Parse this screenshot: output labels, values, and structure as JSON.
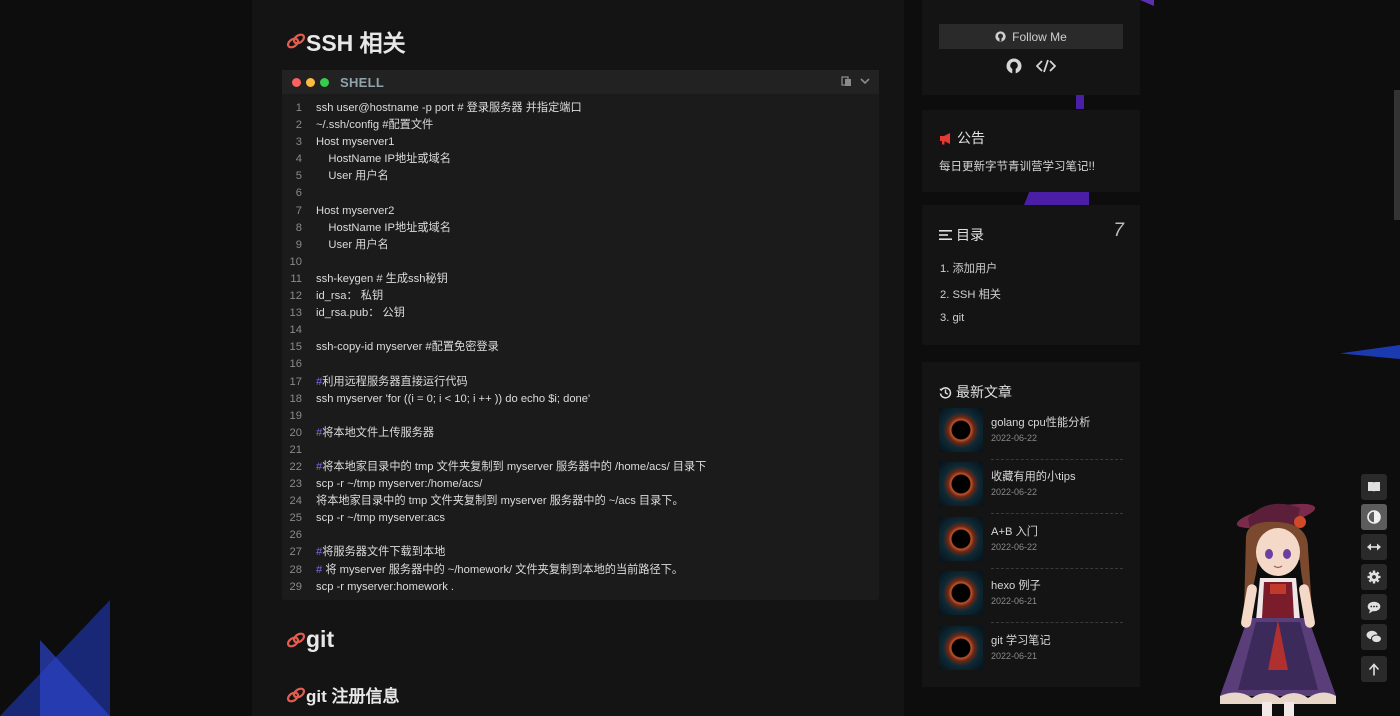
{
  "article": {
    "ssh_heading": "SSH 相关",
    "code_lang": "SHELL",
    "code_lines": [
      {
        "n": "1",
        "text": "ssh user@hostname -p port # 登录服务器 并指定端口"
      },
      {
        "n": "2",
        "text": "~/.ssh/config #配置文件"
      },
      {
        "n": "3",
        "text": "Host myserver1"
      },
      {
        "n": "4",
        "text": "    HostName IP地址或域名"
      },
      {
        "n": "5",
        "text": "    User 用户名"
      },
      {
        "n": "6",
        "text": ""
      },
      {
        "n": "7",
        "text": "Host myserver2"
      },
      {
        "n": "8",
        "text": "    HostName IP地址或域名"
      },
      {
        "n": "9",
        "text": "    User 用户名"
      },
      {
        "n": "10",
        "text": ""
      },
      {
        "n": "11",
        "text": "ssh-keygen # 生成ssh秘钥"
      },
      {
        "n": "12",
        "text": "id_rsa： 私钥"
      },
      {
        "n": "13",
        "text": "id_rsa.pub： 公钥"
      },
      {
        "n": "14",
        "text": ""
      },
      {
        "n": "15",
        "text": "ssh-copy-id myserver #配置免密登录"
      },
      {
        "n": "16",
        "text": ""
      },
      {
        "n": "17",
        "hash": "#",
        "text": "利用远程服务器直接运行代码"
      },
      {
        "n": "18",
        "text": "ssh myserver 'for ((i = 0; i < 10; i ++ )) do echo $i; done'"
      },
      {
        "n": "19",
        "text": ""
      },
      {
        "n": "20",
        "hash": "#",
        "text": "将本地文件上传服务器"
      },
      {
        "n": "21",
        "text": ""
      },
      {
        "n": "22",
        "hash": "#",
        "text": "将本地家目录中的 tmp 文件夹复制到 myserver 服务器中的 /home/acs/ 目录下"
      },
      {
        "n": "23",
        "text": "scp -r ~/tmp myserver:/home/acs/"
      },
      {
        "n": "24",
        "text": "将本地家目录中的 tmp 文件夹复制到 myserver 服务器中的 ~/acs 目录下。"
      },
      {
        "n": "25",
        "text": "scp -r ~/tmp myserver:acs"
      },
      {
        "n": "26",
        "text": ""
      },
      {
        "n": "27",
        "hash": "#",
        "text": "将服务器文件下载到本地"
      },
      {
        "n": "28",
        "hash": "#",
        "text": " 将 myserver 服务器中的 ~/homework/ 文件夹复制到本地的当前路径下。"
      },
      {
        "n": "29",
        "text": "scp -r myserver:homework ."
      }
    ],
    "git_heading": "git",
    "git_sub_heading": "git 注册信息"
  },
  "sidebar": {
    "follow_label": "Follow Me",
    "notice": {
      "title": "公告",
      "text": "每日更新字节青训营学习笔记!!"
    },
    "toc": {
      "title": "目录",
      "count": "7",
      "items": [
        "1. 添加用户",
        "2. SSH 相关",
        "3. git"
      ]
    },
    "recent": {
      "title": "最新文章",
      "posts": [
        {
          "title": "golang cpu性能分析",
          "date": "2022-06-22"
        },
        {
          "title": "收藏有用的小tips",
          "date": "2022-06-22"
        },
        {
          "title": "A+B 入门",
          "date": "2022-06-22"
        },
        {
          "title": "hexo 例子",
          "date": "2022-06-21"
        },
        {
          "title": "git 学习笔记",
          "date": "2022-06-21"
        }
      ]
    }
  },
  "right_tools": [
    "book-icon",
    "theme-toggle-icon",
    "width-toggle-icon",
    "settings-icon",
    "comment-icon",
    "chat-icon",
    "back-to-top-icon"
  ],
  "colors": {
    "accent": "#7c6cf0",
    "anchor": "#e35d4f",
    "notice_icon": "#e53935"
  }
}
